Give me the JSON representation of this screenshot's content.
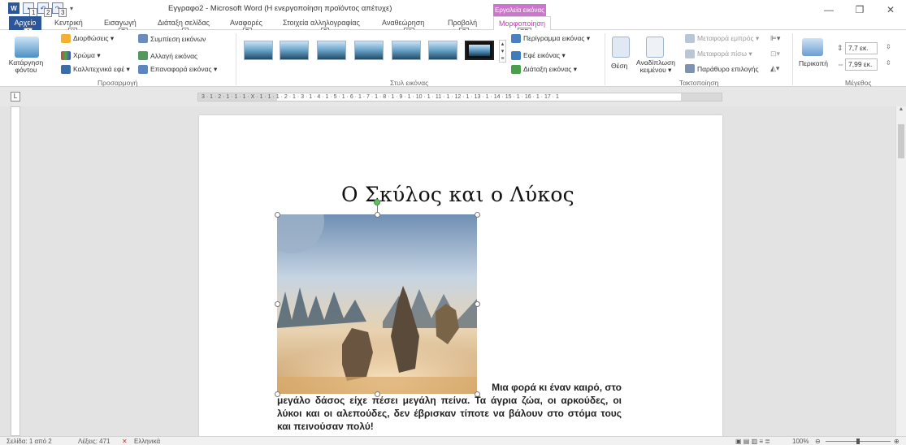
{
  "window": {
    "title": "Εγγραφο2 - Microsoft Word (Η ενεργοποίηση προϊόντος απέτυχε)",
    "context_tab_header": "Εργαλεία εικόνας"
  },
  "qat": {
    "badges": [
      "1",
      "2",
      "3"
    ]
  },
  "tabs": [
    {
      "label": "Αρχείο",
      "key": "Α"
    },
    {
      "label": "Κεντρική",
      "key": "Κ"
    },
    {
      "label": "Εισαγωγή",
      "key": "Ζ"
    },
    {
      "label": "Διάταξη σελίδας",
      "key": "Ι"
    },
    {
      "label": "Αναφορές",
      "key": "Σ"
    },
    {
      "label": "Στοιχεία αλληλογραφίας",
      "key": "Γ"
    },
    {
      "label": "Αναθεώρηση",
      "key": "Ψ"
    },
    {
      "label": "Προβολή",
      "key": "Θ"
    },
    {
      "label": "Μορφοποίηση",
      "key": "ΞΡ"
    }
  ],
  "ribbon": {
    "remove_bg": "Κατάργηση φόντου",
    "corrections": "Διορθώσεις ▾",
    "color": "Χρώμα ▾",
    "artistic": "Καλλιτεχνικά εφέ ▾",
    "compress": "Συμπίεση εικόνων",
    "change_pic": "Αλλαγή εικόνας",
    "reset_pic": "Επαναφορά εικόνας ▾",
    "group_adjust": "Προσαρμογή",
    "group_styles": "Στυλ εικόνας",
    "border": "Περίγραμμα εικόνας ▾",
    "effects": "Εφέ εικόνας ▾",
    "layout": "Διάταξη εικόνας ▾",
    "position": "Θέση",
    "wrap_text": "Αναδίπλωση κειμένου ▾",
    "bring_forward": "Μεταφορά εμπρός ▾",
    "send_backward": "Μεταφορά πίσω ▾",
    "selection_pane": "Παράθυρο επιλογής",
    "group_arrange": "Τακτοποίηση",
    "crop": "Περικοπή",
    "height": "7,7 εκ.",
    "width": "7,99 εκ.",
    "group_size": "Μέγεθος"
  },
  "ruler": {
    "marks": "3 · 1 · 2 · 1 · 1 · 1 · X · 1 · 1 · 1 · 2 · 1 · 3 · 1 · 4 · 1 · 5 · 1 · 6 · 1 · 7 · 1 · 8 · 1 · 9 · 1 · 10 · 1 · 11 · 1 · 12 · 1 · 13 · 1 · 14 · 15 · 1 · 16 · 1 · 17 · 1"
  },
  "document": {
    "heading": "Ο Σκύλος και ο Λύκος",
    "para_first": "Μια φορά κι έναν καιρό, στο",
    "para_rest": "μεγάλο δάσος είχε πέσει μεγάλη πείνα. Τα άγρια ζώα, οι αρκούδες, οι λύκοι και οι αλεπούδες, δεν έβρισκαν τίποτε να βάλουν στο στόμα τους και πεινούσαν πολύ!"
  },
  "status": {
    "page": "Σελίδα: 1 από 2",
    "words": "Λέξεις: 471",
    "language": "Ελληνικά",
    "zoom": "100%"
  },
  "colors": {
    "word_blue": "#2b579a",
    "context_pink": "#cc75cc",
    "format_tab_text": "#b94aa8"
  }
}
